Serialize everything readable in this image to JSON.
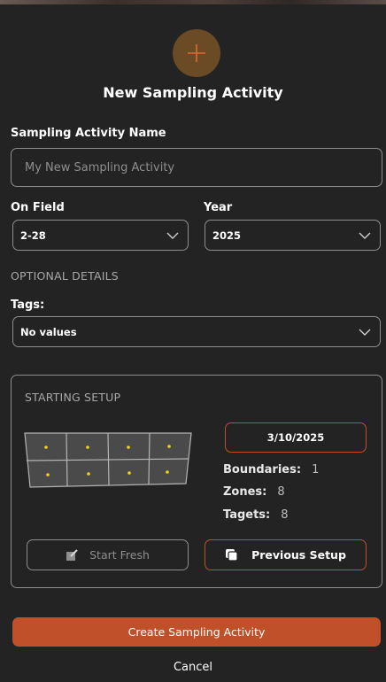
{
  "dialog": {
    "title": "New Sampling Activity",
    "add_icon": "plus-icon"
  },
  "name_field": {
    "label": "Sampling Activity Name",
    "placeholder": "My New Sampling Activity",
    "value": ""
  },
  "field_select": {
    "label": "On Field",
    "value": "2-28"
  },
  "year_select": {
    "label": "Year",
    "value": "2025"
  },
  "optional": {
    "caption": "OPTIONAL DETAILS"
  },
  "tags": {
    "label": "Tags:",
    "value": "No values"
  },
  "setup": {
    "caption": "STARTING SETUP",
    "date": "3/10/2025",
    "stats": [
      {
        "label": "Boundaries:",
        "value": "1"
      },
      {
        "label": "Zones:",
        "value": "8"
      },
      {
        "label": "Tagets:",
        "value": "8"
      }
    ],
    "start_fresh_label": "Start Fresh",
    "previous_setup_label": "Previous Setup",
    "map_icon": "field-zone-map-icon"
  },
  "actions": {
    "create_label": "Create Sampling Activity",
    "cancel_label": "Cancel"
  },
  "colors": {
    "accent": "#c0502a",
    "background": "#232323",
    "add_circle": "#6b4a26",
    "target_dot": "#f2d21a"
  }
}
